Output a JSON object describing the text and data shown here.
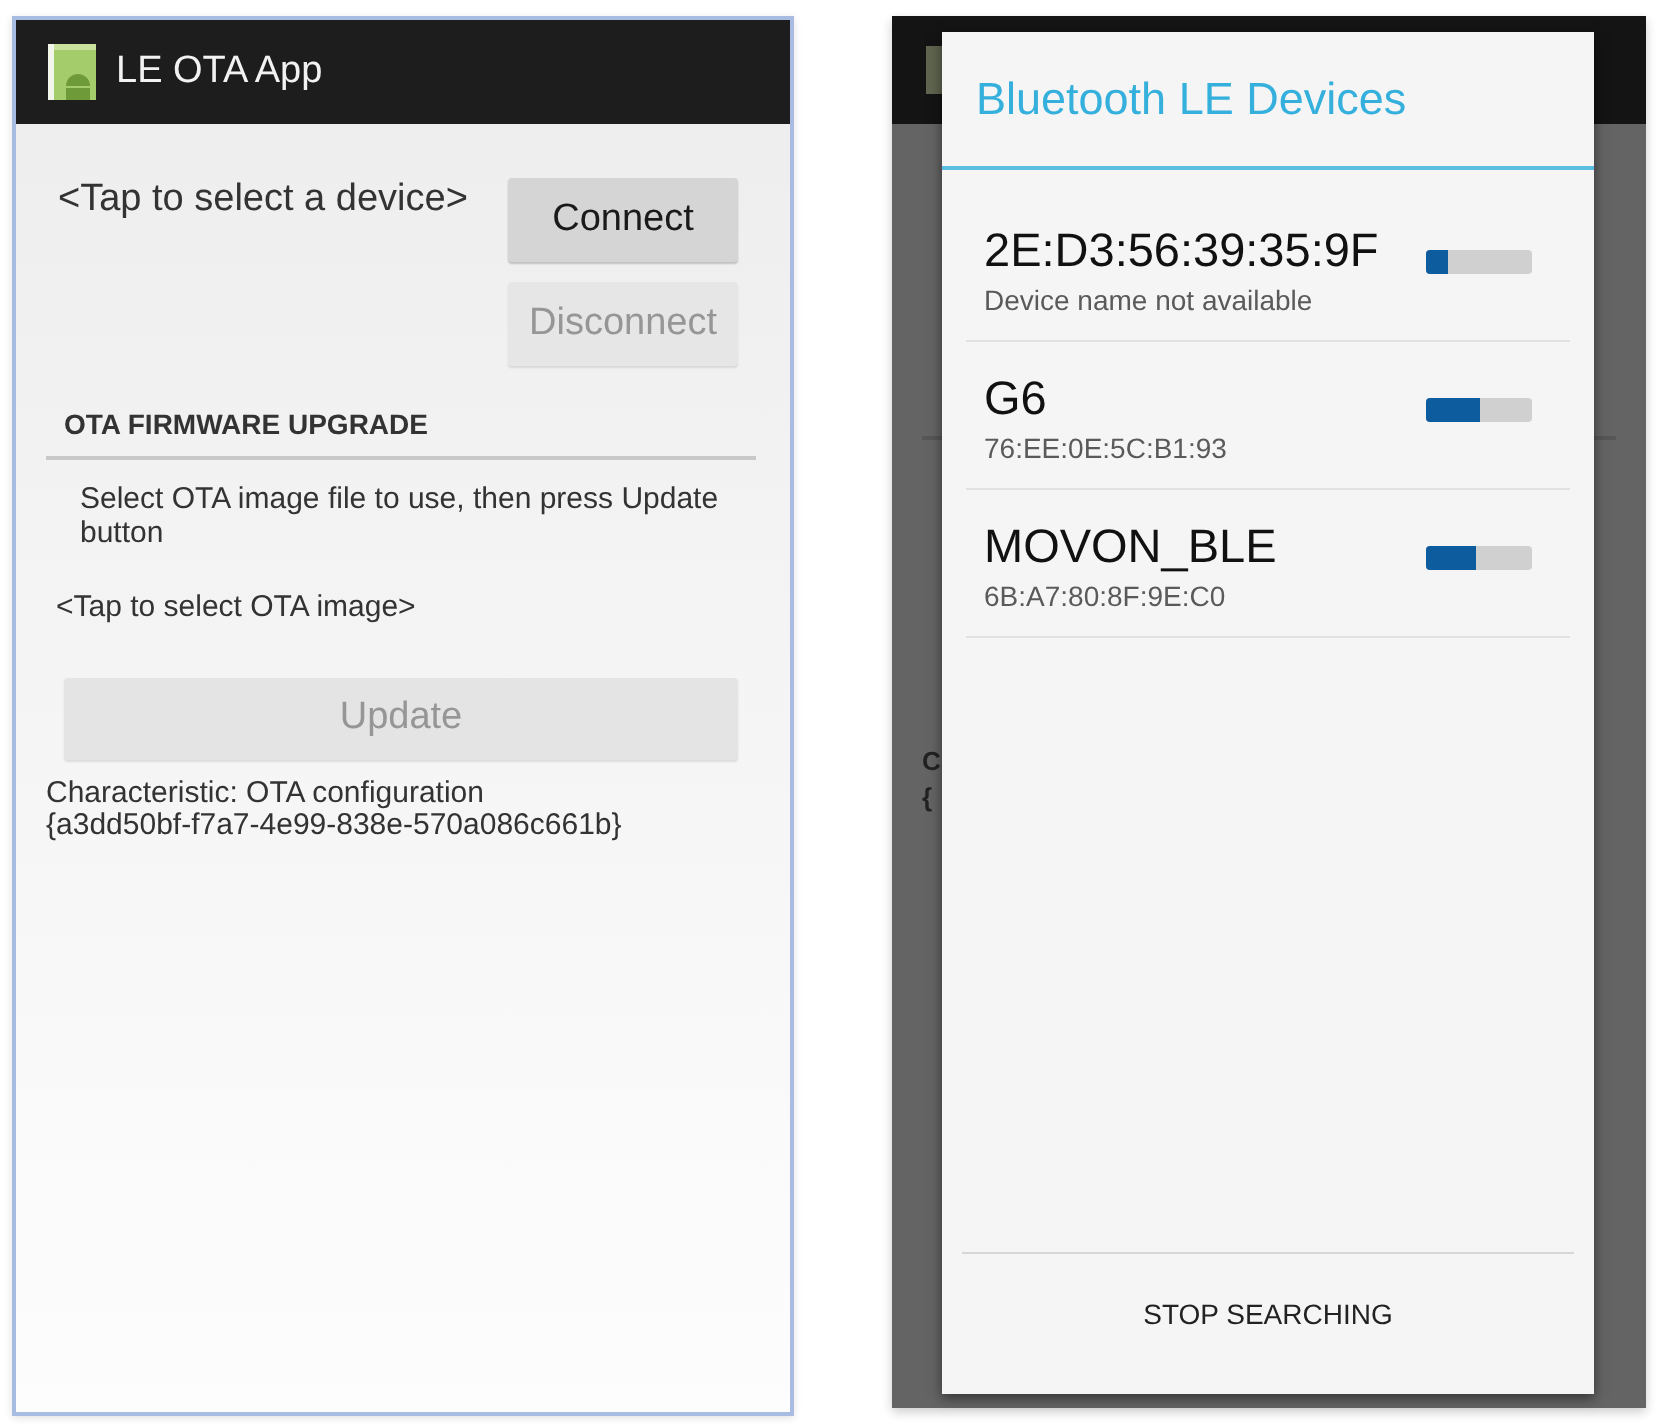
{
  "left_screen": {
    "action_bar": {
      "title": "LE OTA App"
    },
    "device_prompt": "<Tap to select a device>",
    "connection_buttons": [
      {
        "label": "Connect",
        "disabled": false
      },
      {
        "label": "Disconnect",
        "disabled": true
      }
    ],
    "section_header": "OTA FIRMWARE UPGRADE",
    "instructions": "Select OTA image file to use, then press Update button",
    "image_prompt": "<Tap to select OTA image>",
    "update_button": {
      "label": "Update",
      "disabled": true
    },
    "characteristic_lines": [
      "Characteristic: OTA configuration",
      "{a3dd50bf-f7a7-4e99-838e-570a086c661b}"
    ]
  },
  "right_screen": {
    "background_fragments": [
      "C",
      "{"
    ],
    "dialog": {
      "title": "Bluetooth LE Devices",
      "devices": [
        {
          "name": "2E:D3:56:39:35:9F",
          "detail": "Device name not available",
          "level": 0.21
        },
        {
          "name": "G6",
          "detail": "76:EE:0E:5C:B1:93",
          "level": 0.51
        },
        {
          "name": "MOVON_BLE",
          "detail": "6B:A7:80:8F:9E:C0",
          "level": 0.48
        }
      ],
      "action": "STOP SEARCHING"
    }
  }
}
